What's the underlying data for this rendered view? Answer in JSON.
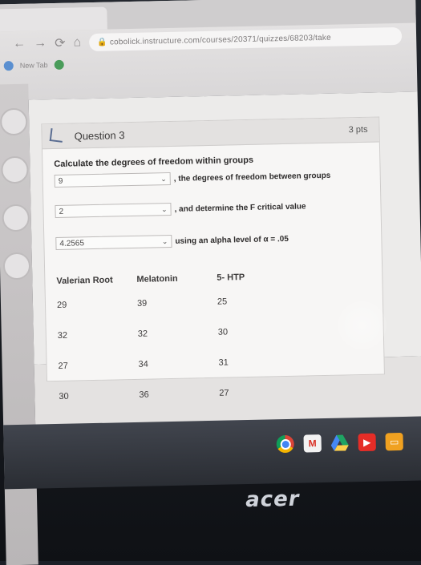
{
  "browser": {
    "url": "cobolick.instructure.com/courses/20371/quizzes/68203/take",
    "new_tab_label": "New Tab"
  },
  "question": {
    "title": "Question 3",
    "points": "3 pts",
    "prompt": "Calculate the degrees of freedom within groups",
    "answers": [
      {
        "value": "9",
        "after": ", the degrees of freedom between groups"
      },
      {
        "value": "2",
        "after": ", and determine the F critical value"
      },
      {
        "value": "4.2565",
        "after": "using an alpha level of α = .05"
      }
    ]
  },
  "table": {
    "headers": [
      "Valerian Root",
      "Melatonin",
      "5- HTP"
    ],
    "rows": [
      [
        "29",
        "39",
        "25"
      ],
      [
        "32",
        "32",
        "30"
      ],
      [
        "27",
        "34",
        "31"
      ],
      [
        "30",
        "36",
        "27"
      ]
    ]
  },
  "taskbar": {
    "icons": [
      "chrome-icon",
      "gmail-icon",
      "drive-icon",
      "youtube-icon",
      "slides-icon"
    ]
  },
  "brand": "acer",
  "colors": {
    "header_bg": "#e3e1e0",
    "card_bg": "#f7f6f5",
    "taskbar_bg": "#2a2d33"
  }
}
